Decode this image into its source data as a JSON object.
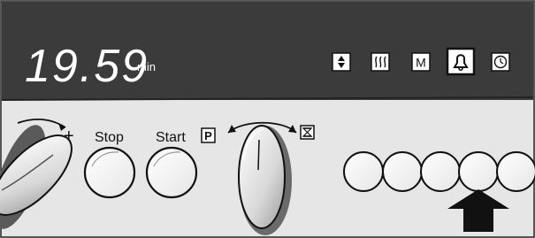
{
  "display": {
    "time": "19.59",
    "unit": "min"
  },
  "mode_icons": [
    {
      "name": "updown-icon",
      "active": false
    },
    {
      "name": "steam-icon",
      "active": false
    },
    {
      "name": "M",
      "active": false
    },
    {
      "name": "bell-icon",
      "active": true
    },
    {
      "name": "clock-icon",
      "active": false
    }
  ],
  "controls": {
    "plus": "+",
    "stop": "Stop",
    "start": "Start",
    "program": "P",
    "timer_symbol": "hourglass-icon"
  },
  "colors": {
    "display_bg": "#3a3a3a",
    "panel_bg": "#dcdcdc",
    "display_text": "#ffffff"
  }
}
